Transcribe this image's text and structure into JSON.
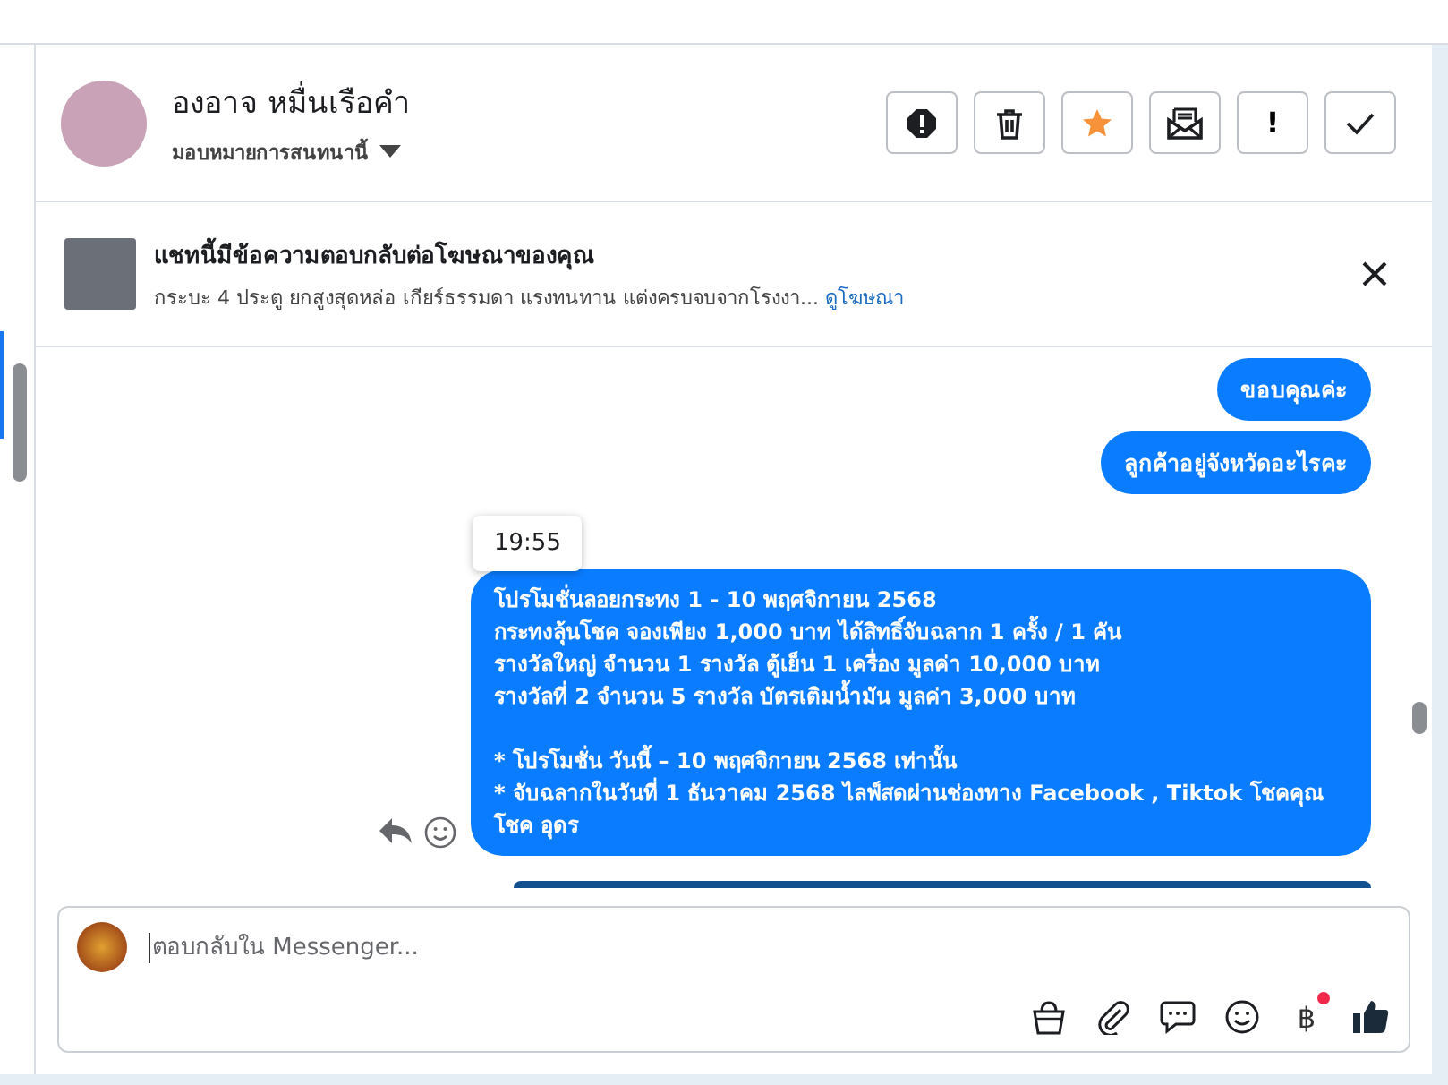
{
  "contact": {
    "name": "องอาจ หมื่นเรือคำ",
    "assign_label": "มอบหมายการสนทนานี้"
  },
  "actions": [
    {
      "kind": "alert"
    },
    {
      "kind": "trash"
    },
    {
      "kind": "star",
      "starred": true
    },
    {
      "kind": "mail"
    },
    {
      "kind": "exclaim",
      "text": "!"
    },
    {
      "kind": "check"
    }
  ],
  "ad_banner": {
    "title": "แชทนี้มีข้อความตอบกลับต่อโฆษณาของคุณ",
    "description": "กระบะ 4 ประตู ยกสูงสุดหล่อ เกียร์ธรรมดา แรงทนทาน แต่งครบจบจากโรงงา...",
    "link": "ดูโฆษณา"
  },
  "messages": [
    {
      "kind": "text",
      "text": "ขอบคุณค่ะ"
    },
    {
      "kind": "text",
      "text": "ลูกค้าอยู่จังหวัดอะไรคะ"
    },
    {
      "kind": "text",
      "time_tooltip": "19:55",
      "text": "โปรโมชั่นลอยกระทง 1 - 10 พฤศจิกายน 2568\nกระทงลุ้นโชค จองเพียง 1,000 บาท ได้สิทธิ์จับฉลาก 1 ครั้ง /  1 คัน\nรางวัลใหญ่  จำนวน 1 รางวัล   ตู้เย็น 1  เครื่อง  มูลค่า    10,000  บาท\nรางวัลที่ 2  จำนวน 5 รางวัล   บัตรเติมน้ำมัน    มูลค่า    3,000   บาท\n\n* โปรโมชั่น วันนี้ – 10 พฤศจิกายน 2568 เท่านั้น\n* จับฉลากในวันที่ 1 ธันวาคม 2568 ไลฟ์สดผ่านช่องทาง Facebook , Tiktok โชคคุณ โชค อุดร"
    },
    {
      "kind": "image"
    }
  ],
  "composer": {
    "placeholder": "ตอบกลับใน Messenger...",
    "tools": [
      {
        "kind": "bag"
      },
      {
        "kind": "clip"
      },
      {
        "kind": "chat"
      },
      {
        "kind": "emoji"
      },
      {
        "kind": "baht",
        "text": "฿",
        "badge": true
      },
      {
        "kind": "like"
      }
    ]
  }
}
